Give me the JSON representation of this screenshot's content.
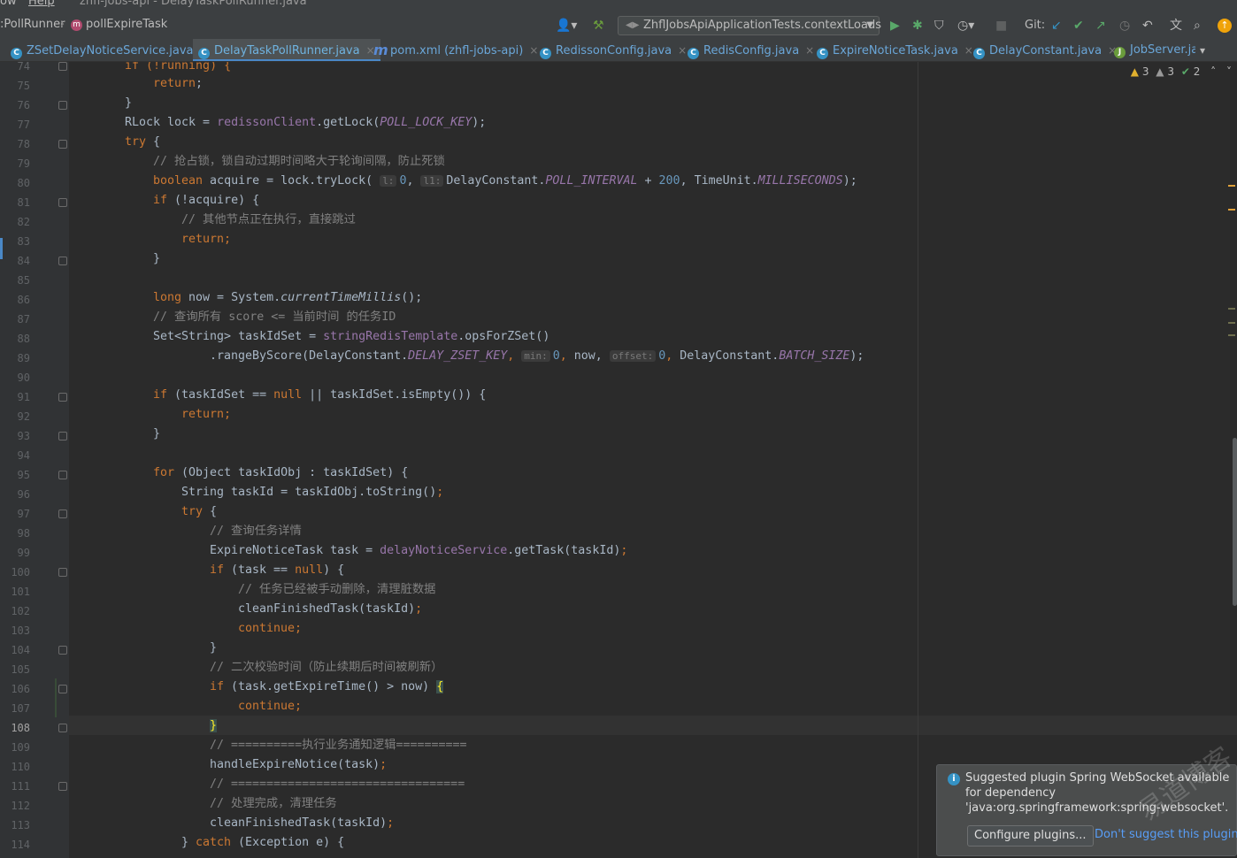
{
  "window": {
    "menu_left": "ow",
    "menu_help": "Help",
    "title": "zhfl-jobs-api - DelayTaskPollRunner.java"
  },
  "breadcrumb": {
    "class_item": ":PollRunner",
    "method_item": "pollExpireTask",
    "method_badge": "m"
  },
  "toolbar": {
    "run_config": "ZhflJobsApiApplicationTests.contextLoads",
    "git_label": "Git:"
  },
  "tabs": [
    {
      "label": "ZSetDelayNoticeService.java",
      "icon": "C",
      "active": false
    },
    {
      "label": "DelayTaskPollRunner.java",
      "icon": "C",
      "active": true
    },
    {
      "label": "pom.xml (zhfl-jobs-api)",
      "icon": "m",
      "active": false
    },
    {
      "label": "RedissonConfig.java",
      "icon": "C",
      "active": false
    },
    {
      "label": "RedisConfig.java",
      "icon": "C",
      "active": false
    },
    {
      "label": "ExpireNoticeTask.java",
      "icon": "C",
      "active": false
    },
    {
      "label": "DelayConstant.java",
      "icon": "C",
      "active": false
    },
    {
      "label": "JobServer.ja",
      "icon": "J",
      "active": false
    }
  ],
  "inspections": {
    "warnings": "3",
    "weak_warnings": "3",
    "ok": "2"
  },
  "editor": {
    "current_line": "108",
    "line_numbers": [
      "74",
      "75",
      "76",
      "77",
      "78",
      "79",
      "80",
      "81",
      "82",
      "83",
      "84",
      "85",
      "86",
      "87",
      "88",
      "89",
      "90",
      "91",
      "92",
      "93",
      "94",
      "95",
      "96",
      "97",
      "98",
      "99",
      "100",
      "101",
      "102",
      "103",
      "104",
      "105",
      "106",
      "107",
      "108",
      "109",
      "110",
      "111",
      "112",
      "113",
      "114"
    ],
    "code": {
      "l74": "if (!running) {",
      "l75_kw": "return",
      "l77_a": "RLock lock = ",
      "l77_f": "redissonClient",
      "l77_b": ".getLock(",
      "l77_c": "POLL_LOCK_KEY",
      "l77_d": ");",
      "l78_kw": "try",
      "l78_b": " {",
      "l79": "// 抢占锁，锁自动过期时间略大于轮询间隔，防止死锁",
      "l80_kw": "boolean",
      "l80_a": " acquire = lock.tryLock( ",
      "l80_h1": "l:",
      "l80_n1": "0",
      "l80_h2": "l1:",
      "l80_b": "DelayConstant.",
      "l80_c": "POLL_INTERVAL",
      "l80_d": " + ",
      "l80_n2": "200",
      "l80_e": ", TimeUnit.",
      "l80_f": "MILLISECONDS",
      "l80_g": ");",
      "l81_kw": "if",
      "l81_a": " (!acquire) {",
      "l82": "// 其他节点正在执行，直接跳过",
      "l83_kw": "return",
      "l84": "}",
      "l86_kw": "long",
      "l86_a": " now = System.",
      "l86_b": "currentTimeMillis",
      "l86_c": "();",
      "l87": "// 查询所有 score <= 当前时间 的任务ID",
      "l88_a": "Set<String> taskIdSet = ",
      "l88_f": "stringRedisTemplate",
      "l88_b": ".opsForZSet()",
      "l89_a": ".rangeByScore(DelayConstant.",
      "l89_c": "DELAY_ZSET_KEY",
      "l89_h1": "min:",
      "l89_n1": "0",
      "l89_b": " now, ",
      "l89_h2": "offset:",
      "l89_n2": "0",
      "l89_d": " DelayConstant.",
      "l89_e": "BATCH_SIZE",
      "l89_g": ");",
      "l91_kw": "if",
      "l91_a": " (taskIdSet == ",
      "l91_null": "null",
      "l91_b": " || taskIdSet.isEmpty()) {",
      "l92_kw": "return",
      "l93": "}",
      "l95_kw": "for",
      "l95_a": " (Object taskIdObj : taskIdSet) {",
      "l96_a": "String taskId = taskIdObj.toString()",
      "l97_kw": "try",
      "l97_a": " {",
      "l98": "// 查询任务详情",
      "l99_a": "ExpireNoticeTask task = ",
      "l99_f": "delayNoticeService",
      "l99_b": ".getTask(taskId)",
      "l100_kw": "if",
      "l100_a": " (task == ",
      "l100_null": "null",
      "l100_b": ") {",
      "l101": "// 任务已经被手动删除，清理脏数据",
      "l102_a": "cleanFinishedTask(taskId)",
      "l103_kw": "continue",
      "l104": "}",
      "l105": "// 二次校验时间（防止续期后时间被刷新）",
      "l106_kw": "if",
      "l106_a": " (task.getExpireTime() > now) ",
      "l106_brace": "{",
      "l107_kw": "continue",
      "l108_brace": "}",
      "l109": "// ==========执行业务通知逻辑==========",
      "l110_a": "handleExpireNotice(task)",
      "l111": "// =================================",
      "l112": "// 处理完成，清理任务",
      "l113_a": "cleanFinishedTask(taskId)",
      "l114_a": "} ",
      "l114_kw": "catch",
      "l114_b": " (Exception e) {",
      "semi": ";",
      "rbrace": "}"
    }
  },
  "notification": {
    "message": "Suggested plugin Spring WebSocket available for dependency 'java:org.springframework:spring-websocket'.",
    "configure_button": "Configure plugins...",
    "dismiss_link": "Don't suggest this plugin"
  },
  "watermark": "易道博客",
  "colors": {
    "background": "#2b2b2b",
    "keyword": "#cc7832",
    "field": "#9876aa",
    "number": "#6897bb",
    "comment": "#808080",
    "accent": "#4a88c7"
  }
}
